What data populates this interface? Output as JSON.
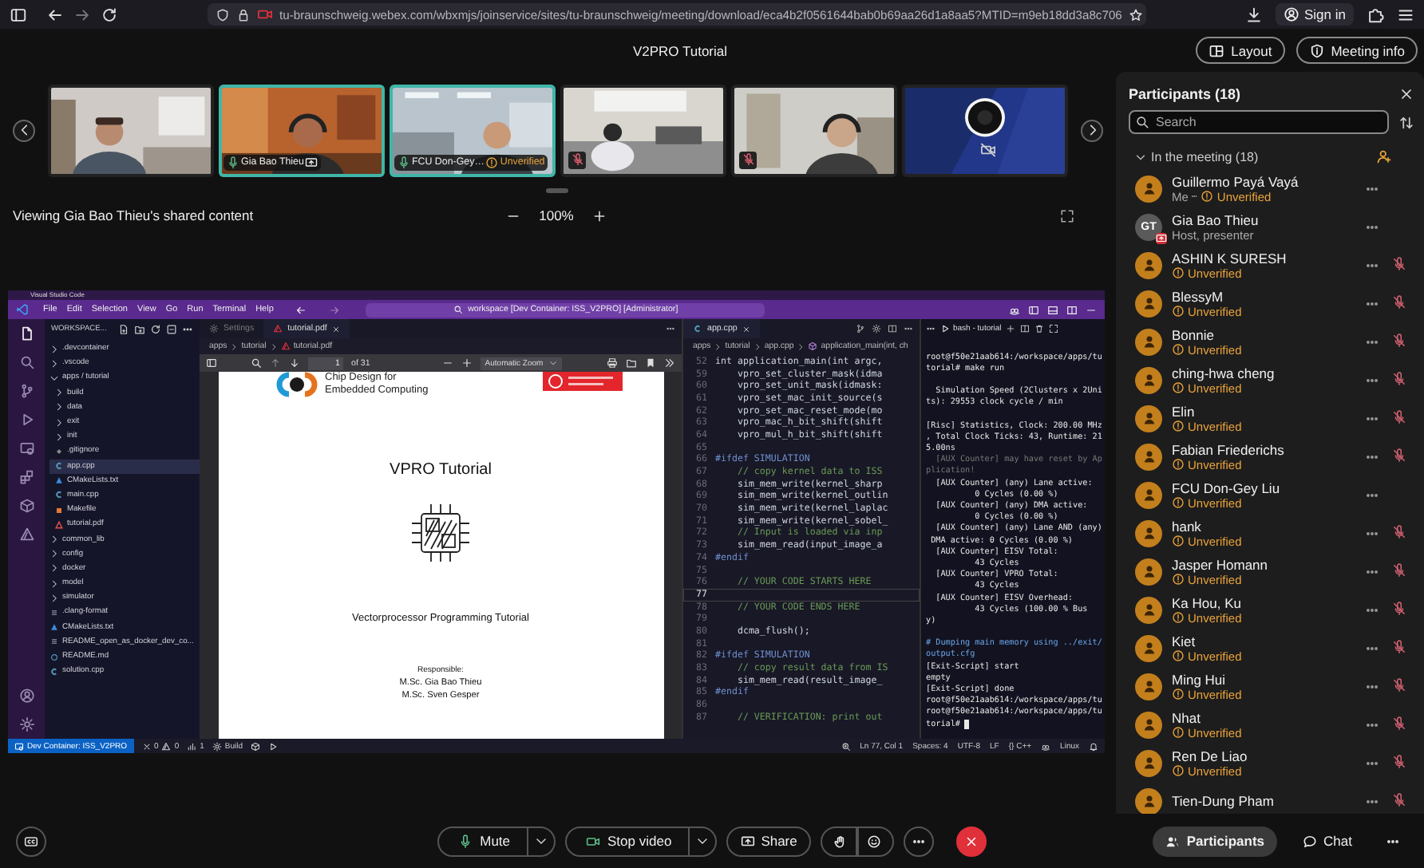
{
  "browser": {
    "url": "tu-braunschweig.webex.com/wbxmjs/joinservice/sites/tu-braunschweig/meeting/download/eca4b2f0561644bab0b69aa26d1a8aa5?MTID=m9eb18dd3a8c706",
    "sign_in": "Sign in"
  },
  "meeting": {
    "title": "V2PRO Tutorial",
    "buttons": [
      {
        "kind": "layout",
        "label": "Layout"
      },
      {
        "kind": "info",
        "label": "Meeting info"
      }
    ]
  },
  "tiles": [
    {
      "kind": "picture",
      "highlighted": false
    },
    {
      "kind": "picture",
      "highlighted": true,
      "name": "Gia Bao Thieu",
      "muted": false,
      "presenting": true
    },
    {
      "kind": "picture",
      "highlighted": true,
      "name": "FCU Don-Gey…",
      "muted": false,
      "status": "Unverified"
    },
    {
      "kind": "picture",
      "highlighted": false,
      "muted": true
    },
    {
      "kind": "picture",
      "highlighted": false,
      "muted": true
    },
    {
      "kind": "picture",
      "highlighted": false,
      "video_off": true
    }
  ],
  "viewing": {
    "label": "Viewing Gia Bao Thieu's shared content",
    "zoom": "100%"
  },
  "vscode": {
    "app_title": "Visual Studio Code",
    "menu": [
      "File",
      "Edit",
      "Selection",
      "View",
      "Go",
      "Run",
      "Terminal",
      "Help"
    ],
    "command_center": "workspace [Dev Container: ISS_V2PRO] [Administrator]",
    "explorer": {
      "title": "WORKSPACE...",
      "items": [
        {
          "label": ".devcontainer",
          "kind": "folder",
          "expanded": false,
          "selected": false
        },
        {
          "label": ".vscode",
          "kind": "folder",
          "expanded": false,
          "selected": false
        },
        {
          "label": "apps / tutorial",
          "kind": "folder",
          "expanded": true,
          "selected": false,
          "children": [
            {
              "label": "build",
              "kind": "folder",
              "expanded": false,
              "selected": false
            },
            {
              "label": "data",
              "kind": "folder",
              "expanded": false,
              "selected": false
            },
            {
              "label": "exit",
              "kind": "folder",
              "expanded": false,
              "selected": false
            },
            {
              "label": "init",
              "kind": "folder",
              "expanded": false,
              "selected": false
            },
            {
              "label": ".gitignore",
              "kind": "ignore",
              "selected": false
            },
            {
              "label": "app.cpp",
              "kind": "cpp",
              "selected": true
            },
            {
              "label": "CMakeLists.txt",
              "kind": "cmake",
              "selected": false
            },
            {
              "label": "main.cpp",
              "kind": "cpp",
              "selected": false
            },
            {
              "label": "Makefile",
              "kind": "make",
              "selected": false
            },
            {
              "label": "tutorial.pdf",
              "kind": "pdf",
              "selected": false
            }
          ]
        },
        {
          "label": "common_lib",
          "kind": "folder",
          "expanded": false,
          "selected": false
        },
        {
          "label": "config",
          "kind": "folder",
          "expanded": false,
          "selected": false
        },
        {
          "label": "docker",
          "kind": "folder",
          "expanded": false,
          "selected": false
        },
        {
          "label": "model",
          "kind": "folder",
          "expanded": false,
          "selected": false
        },
        {
          "label": "simulator",
          "kind": "folder",
          "expanded": false,
          "selected": false
        },
        {
          "label": ".clang-format",
          "kind": "text",
          "selected": false
        },
        {
          "label": "CMakeLists.txt",
          "kind": "cmake",
          "selected": false
        },
        {
          "label": "README_open_as_docker_dev_co...",
          "kind": "text",
          "selected": false
        },
        {
          "label": "README.md",
          "kind": "info",
          "selected": false
        },
        {
          "label": "solution.cpp",
          "kind": "cpp",
          "selected": false
        }
      ]
    },
    "pdf_editor": {
      "tabs": [
        {
          "label": "Settings",
          "kind": "settings",
          "selected": false
        },
        {
          "label": "tutorial.pdf",
          "kind": "pdf",
          "selected": true
        }
      ],
      "breadcrumb": [
        "apps",
        "tutorial",
        "tutorial.pdf"
      ],
      "page": "1",
      "page_count": "of 31",
      "zoom": "Automatic Zoom",
      "document": {
        "logo_text": [
          "Chip Design for",
          "Embedded Computing"
        ],
        "title": "VPRO Tutorial",
        "subtitle": "Vectorprocessor Programming Tutorial",
        "authors": [
          "Responsible:",
          "M.Sc. Gia Bao Thieu",
          "M.Sc. Sven Gesper"
        ]
      }
    },
    "code_editor": {
      "tab": "app.cpp",
      "breadcrumb": [
        "apps",
        "tutorial",
        "app.cpp",
        "application_main(int, ch"
      ],
      "lines": [
        {
          "n": "52",
          "text": "int application_main(int argc,",
          "kind": "code",
          "current": false
        },
        {
          "n": "59",
          "text": "    vpro_set_cluster_mask(idma",
          "kind": "code",
          "current": false
        },
        {
          "n": "60",
          "text": "    vpro_set_unit_mask(idmask:",
          "kind": "code",
          "current": false
        },
        {
          "n": "61",
          "text": "    vpro_set_mac_init_source(s",
          "kind": "code",
          "current": false
        },
        {
          "n": "62",
          "text": "    vpro_set_mac_reset_mode(mo",
          "kind": "code",
          "current": false
        },
        {
          "n": "63",
          "text": "    vpro_mac_h_bit_shift(shift",
          "kind": "code",
          "current": false
        },
        {
          "n": "64",
          "text": "    vpro_mul_h_bit_shift(shift",
          "kind": "code",
          "current": false
        },
        {
          "n": "65",
          "current": false
        },
        {
          "n": "66",
          "text": "#ifdef SIMULATION",
          "kind": "directive",
          "current": false
        },
        {
          "n": "67",
          "text": "    // copy kernel data to ISS",
          "kind": "comment",
          "current": false
        },
        {
          "n": "68",
          "text": "    sim_mem_write(kernel_sharp",
          "kind": "code",
          "current": false
        },
        {
          "n": "69",
          "text": "    sim_mem_write(kernel_outlin",
          "kind": "code",
          "current": false
        },
        {
          "n": "70",
          "text": "    sim_mem_write(kernel_laplac",
          "kind": "code",
          "current": false
        },
        {
          "n": "71",
          "text": "    sim_mem_write(kernel_sobel_",
          "kind": "code",
          "current": false
        },
        {
          "n": "72",
          "text": "    // Input is loaded via inp",
          "kind": "comment",
          "current": false
        },
        {
          "n": "73",
          "text": "    sim_mem_read(input_image_a",
          "kind": "code",
          "current": false
        },
        {
          "n": "74",
          "text": "#endif",
          "kind": "directive",
          "current": false
        },
        {
          "n": "75",
          "current": false
        },
        {
          "n": "76",
          "text": "    // YOUR CODE STARTS HERE",
          "kind": "comment",
          "current": false
        },
        {
          "n": "77",
          "current": true
        },
        {
          "n": "78",
          "text": "    // YOUR CODE ENDS HERE",
          "kind": "comment",
          "current": false
        },
        {
          "n": "79",
          "current": false
        },
        {
          "n": "80",
          "text": "    dcma_flush();",
          "kind": "code",
          "current": false
        },
        {
          "n": "81",
          "current": false
        },
        {
          "n": "82",
          "text": "#ifdef SIMULATION",
          "kind": "directive",
          "current": false
        },
        {
          "n": "83",
          "text": "    // copy result data from IS",
          "kind": "comment",
          "current": false
        },
        {
          "n": "84",
          "text": "    sim_mem_read(result_image_",
          "kind": "code",
          "current": false
        },
        {
          "n": "85",
          "text": "#endif",
          "kind": "directive",
          "current": false
        },
        {
          "n": "86",
          "current": false
        },
        {
          "n": "87",
          "text": "    // VERIFICATION: print out",
          "kind": "comment",
          "current": false
        }
      ]
    },
    "terminal": {
      "tab": "bash - tutorial",
      "lines": [
        {
          "text": "root@f50e21aab614:/workspace/apps/tu",
          "kind": "output"
        },
        {
          "text": "torial# make run",
          "kind": "output"
        },
        {
          "text": "  Simulation Speed (2Clusters x 2Uni",
          "kind": "output",
          "space_before": true
        },
        {
          "text": "ts): 29553 clock cycle / min",
          "kind": "output"
        },
        {
          "text": "[Risc] Statistics, Clock: 200.00 MHz",
          "kind": "output",
          "space_before": true
        },
        {
          "text": ", Total Clock Ticks: 43, Runtime: 21",
          "kind": "output"
        },
        {
          "text": "5.00ns",
          "kind": "output"
        },
        {
          "text": "  [AUX Counter] may have reset by Ap",
          "kind": "dim"
        },
        {
          "text": "plication!",
          "kind": "dim"
        },
        {
          "text": "  [AUX Counter] (any) Lane active:",
          "kind": "output"
        },
        {
          "text": "          0 Cycles (0.00 %)",
          "kind": "output"
        },
        {
          "text": "  [AUX Counter] (any) DMA active:",
          "kind": "output"
        },
        {
          "text": "          0 Cycles (0.00 %)",
          "kind": "output"
        },
        {
          "text": "  [AUX Counter] (any) Lane AND (any)",
          "kind": "output"
        },
        {
          "text": " DMA active: 0 Cycles (0.00 %)",
          "kind": "output"
        },
        {
          "text": "  [AUX Counter] EISV Total:",
          "kind": "output"
        },
        {
          "text": "          43 Cycles",
          "kind": "output"
        },
        {
          "text": "  [AUX Counter] VPRO Total:",
          "kind": "output"
        },
        {
          "text": "          43 Cycles",
          "kind": "output"
        },
        {
          "text": "  [AUX Counter] EISV Overhead:",
          "kind": "output"
        },
        {
          "text": "          43 Cycles (100.00 % Bus",
          "kind": "output"
        },
        {
          "text": "y)",
          "kind": "output"
        },
        {
          "text": "# Dumping main memory using ../exit/",
          "kind": "info",
          "space_before": true
        },
        {
          "text": "output.cfg",
          "kind": "info"
        },
        {
          "text": "[Exit-Script] start",
          "kind": "output"
        },
        {
          "text": "empty",
          "kind": "output"
        },
        {
          "text": "[Exit-Script] done",
          "kind": "output"
        },
        {
          "text": "root@f50e21aab614:/workspace/apps/tu",
          "kind": "output"
        },
        {
          "text": "root@f50e21aab614:/workspace/apps/tu",
          "kind": "output"
        },
        {
          "text": "torial#",
          "kind": "output",
          "cursor": true
        }
      ]
    },
    "status_bar": {
      "remote": "Dev Container: ISS_V2PRO",
      "errors": "0",
      "warnings": "0",
      "ports": "1",
      "build": "Build",
      "right": [
        "Ln 77, Col 1",
        "Spaces: 4",
        "UTF-8",
        "LF",
        "{} C++",
        "Linux"
      ]
    }
  },
  "participants": {
    "title": "Participants (18)",
    "search_placeholder": "Search",
    "group": "In the meeting (18)",
    "group_expanded": true,
    "people": [
      {
        "name": "Guillermo Payá Vayá",
        "role": "Me",
        "status": "Unverified",
        "muted": false
      },
      {
        "name": "Gia Bao Thieu",
        "role": "Host, presenter",
        "initials": "GT",
        "presenting": true,
        "muted": false
      },
      {
        "name": "ASHIN K SURESH",
        "status": "Unverified",
        "muted": true
      },
      {
        "name": "BlessyM",
        "status": "Unverified",
        "muted": true
      },
      {
        "name": "Bonnie",
        "status": "Unverified",
        "muted": true
      },
      {
        "name": "ching-hwa cheng",
        "status": "Unverified",
        "muted": true
      },
      {
        "name": "Elin",
        "status": "Unverified",
        "muted": true
      },
      {
        "name": "Fabian Friederichs",
        "status": "Unverified",
        "muted": true
      },
      {
        "name": "FCU Don-Gey Liu",
        "status": "Unverified",
        "muted": false
      },
      {
        "name": "hank",
        "status": "Unverified",
        "muted": true
      },
      {
        "name": "Jasper Homann",
        "status": "Unverified",
        "muted": true
      },
      {
        "name": "Ka Hou, Ku",
        "status": "Unverified",
        "muted": true
      },
      {
        "name": "Kiet",
        "status": "Unverified",
        "muted": true
      },
      {
        "name": "Ming Hui",
        "status": "Unverified",
        "muted": true
      },
      {
        "name": "Nhat",
        "status": "Unverified",
        "muted": true
      },
      {
        "name": "Ren De Liao",
        "status": "Unverified",
        "muted": true
      },
      {
        "name": "Tien-Dung Pham",
        "muted": true
      }
    ]
  },
  "controls": {
    "left": [
      {
        "kind": "captions"
      }
    ],
    "center": [
      {
        "kind": "mute",
        "label": "Mute"
      },
      {
        "kind": "video",
        "label": "Stop video"
      },
      {
        "kind": "share",
        "label": "Share"
      },
      {
        "kind": "hand"
      },
      {
        "kind": "reactions"
      },
      {
        "kind": "more"
      },
      {
        "kind": "leave"
      }
    ],
    "right": [
      {
        "kind": "participants",
        "label": "Participants",
        "selected": true
      },
      {
        "kind": "chat",
        "label": "Chat",
        "selected": false
      },
      {
        "kind": "more"
      }
    ]
  }
}
